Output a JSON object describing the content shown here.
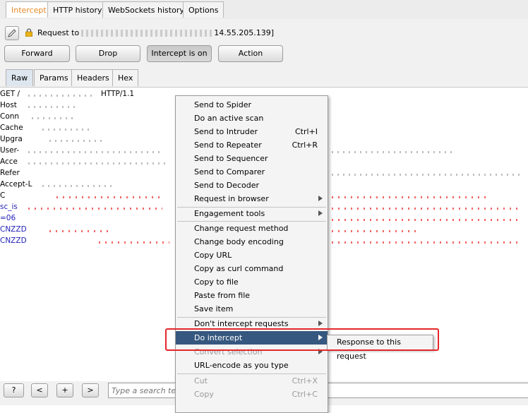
{
  "tabs": [
    "Intercept",
    "HTTP history",
    "WebSockets history",
    "Options"
  ],
  "request_label": "Request to",
  "request_target_tail": "14.55.205.139]",
  "actions": [
    "Forward",
    "Drop",
    "Intercept is on",
    "Action"
  ],
  "subtabs": [
    "Raw",
    "Params",
    "Headers",
    "Hex"
  ],
  "editor_lines": [
    {
      "text": "GET /",
      "tail": "HTTP/1.1"
    },
    {
      "text": "Host"
    },
    {
      "text": "Conn"
    },
    {
      "text": "Cache"
    },
    {
      "text": "Upgra"
    },
    {
      "text": "User-"
    },
    {
      "text": "Acce"
    },
    {
      "text": "Refer"
    },
    {
      "text": "Accept-L"
    },
    {
      "text": "C"
    },
    {
      "text": "sc_is"
    },
    {
      "text": "=06"
    },
    {
      "text": "CNZZD"
    },
    {
      "text": "CNZZD"
    }
  ],
  "menu_items": [
    {
      "label": "Send to Spider"
    },
    {
      "label": "Do an active scan"
    },
    {
      "label": "Send to Intruder",
      "shortcut": "Ctrl+I"
    },
    {
      "label": "Send to Repeater",
      "shortcut": "Ctrl+R"
    },
    {
      "label": "Send to Sequencer"
    },
    {
      "label": "Send to Comparer"
    },
    {
      "label": "Send to Decoder"
    },
    {
      "label": "Request in browser",
      "submenu": true
    },
    {
      "label": "Engagement tools",
      "submenu": true
    },
    {
      "label": "Change request method"
    },
    {
      "label": "Change body encoding"
    },
    {
      "label": "Copy URL"
    },
    {
      "label": "Copy as curl command"
    },
    {
      "label": "Copy to file"
    },
    {
      "label": "Paste from file"
    },
    {
      "label": "Save item"
    },
    {
      "label": "Don't intercept requests",
      "submenu": true
    },
    {
      "label": "Do intercept",
      "submenu": true
    },
    {
      "label": "Convert selection",
      "submenu": true
    },
    {
      "label": "URL-encode as you type"
    },
    {
      "label": "Cut",
      "shortcut": "Ctrl+X"
    },
    {
      "label": "Copy",
      "shortcut": "Ctrl+C"
    }
  ],
  "submenu_item": "Response to this request",
  "search": {
    "placeholder": "Type a search term"
  },
  "nav_buttons": [
    "?",
    "<",
    "+",
    ">"
  ],
  "colors": {
    "active_tab_text": "#e58925",
    "menu_selected": "#36587f",
    "highlight_box": "#e4272b"
  }
}
